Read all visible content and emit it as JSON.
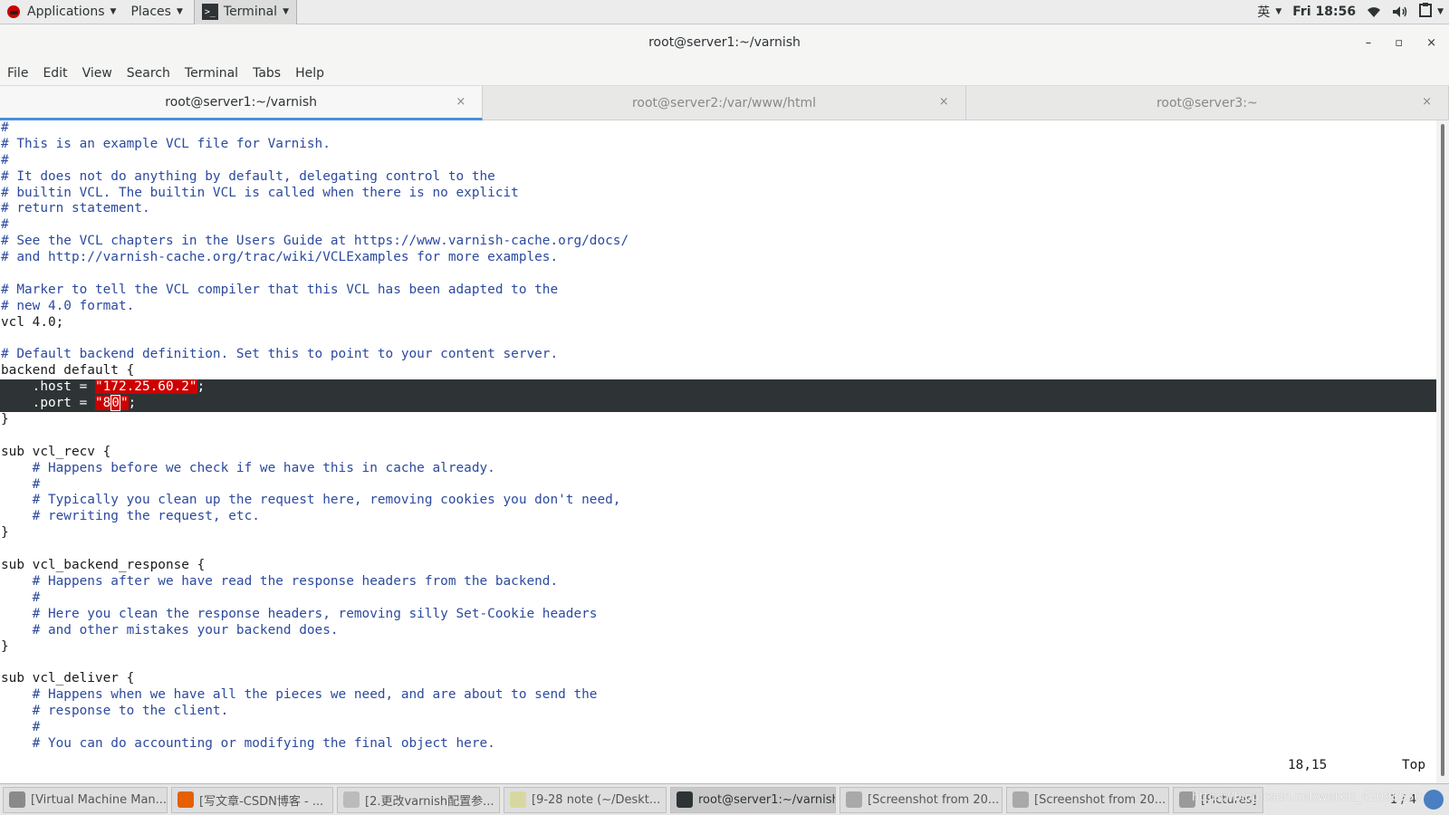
{
  "topbar": {
    "applications": "Applications",
    "places": "Places",
    "terminal": "Terminal",
    "input_method": "英",
    "clock": "Fri 18:56"
  },
  "window": {
    "title": "root@server1:~/varnish",
    "minimize": "–",
    "maximize": "▫",
    "close": "×"
  },
  "menu": [
    "File",
    "Edit",
    "View",
    "Search",
    "Terminal",
    "Tabs",
    "Help"
  ],
  "tabs": [
    {
      "label": "root@server1:~/varnish",
      "close": "×"
    },
    {
      "label": "root@server2:/var/www/html",
      "close": "×"
    },
    {
      "label": "root@server3:~",
      "close": "×"
    }
  ],
  "editor": {
    "lines": [
      "#",
      "# This is an example VCL file for Varnish.",
      "#",
      "# It does not do anything by default, delegating control to the",
      "# builtin VCL. The builtin VCL is called when there is no explicit",
      "# return statement.",
      "#",
      "# See the VCL chapters in the Users Guide at https://www.varnish-cache.org/docs/",
      "# and http://varnish-cache.org/trac/wiki/VCLExamples for more examples.",
      "",
      "# Marker to tell the VCL compiler that this VCL has been adapted to the",
      "# new 4.0 format.",
      "vcl 4.0;",
      "",
      "# Default backend definition. Set this to point to your content server.",
      "backend default {",
      "",
      "",
      "}",
      "",
      "sub vcl_recv {",
      "    # Happens before we check if we have this in cache already.",
      "    #",
      "    # Typically you clean up the request here, removing cookies you don't need,",
      "    # rewriting the request, etc.",
      "}",
      "",
      "sub vcl_backend_response {",
      "    # Happens after we have read the response headers from the backend.",
      "    #",
      "    # Here you clean the response headers, removing silly Set-Cookie headers",
      "    # and other mistakes your backend does.",
      "}",
      "",
      "sub vcl_deliver {",
      "    # Happens when we have all the pieces we need, and are about to send the",
      "    # response to the client.",
      "    #",
      "    # You can do accounting or modifying the final object here."
    ],
    "host_prefix": "    .host = ",
    "host_value": "\"172.25.60.2\"",
    "host_suffix": ";",
    "port_prefix": "    .port = ",
    "port_open": "\"8",
    "port_cursor": "0",
    "port_close": "\"",
    "port_suffix": ";",
    "cursor_pos": "18,15",
    "scroll_pos": "Top"
  },
  "taskbar": {
    "items": [
      "[Virtual Machine Man...",
      "[写文章-CSDN博客 - ...",
      "[2.更改varnish配置参...",
      "[9-28 note (~/Deskt...",
      "root@server1:~/varnish",
      "[Screenshot from 20...",
      "[Screenshot from 20...",
      "[Pictures]"
    ],
    "pager": "1 / 4",
    "watermark": "https://blog.csdn.net/weixin_42098550"
  }
}
